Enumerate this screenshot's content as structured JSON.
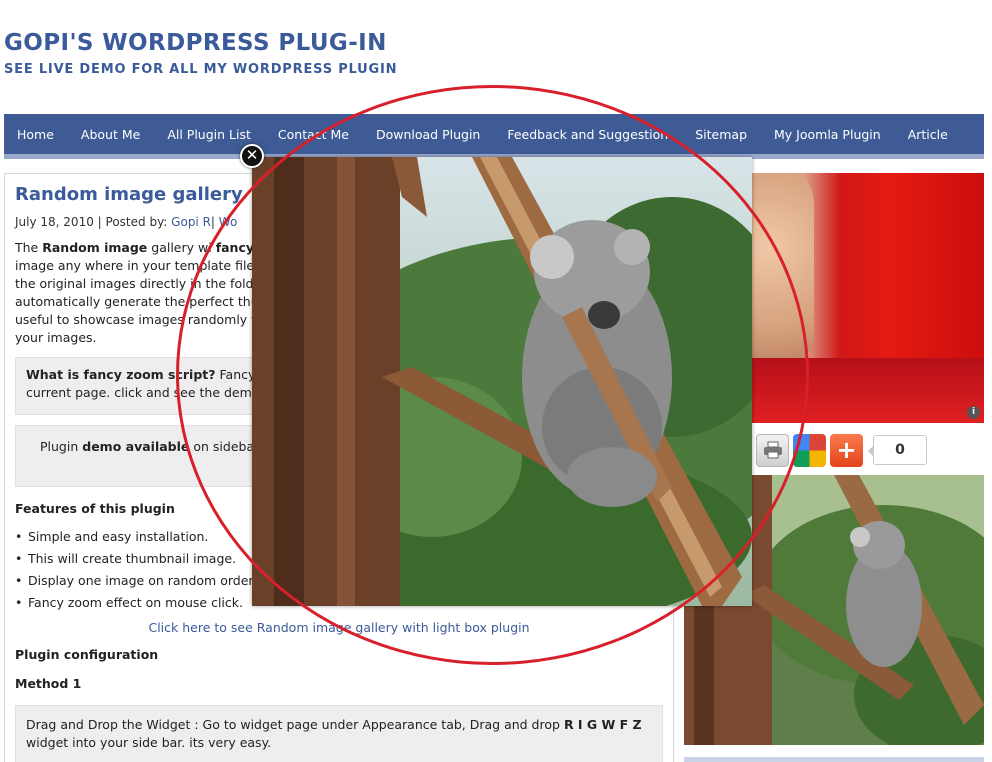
{
  "site": {
    "title": "GOPI'S WORDPRESS PLUG-IN",
    "description": "SEE LIVE DEMO FOR ALL MY WORDPRESS PLUGIN"
  },
  "nav": {
    "items": [
      "Home",
      "About Me",
      "All Plugin List",
      "Contact Me",
      "Download Plugin",
      "Feedback and Suggestion",
      "Sitemap",
      "My Joomla Plugin",
      "Article"
    ]
  },
  "post": {
    "title": "Random image gallery",
    "date": "July 18, 2010",
    "posted_by_label": "| Posted by:",
    "author": "Gopi R",
    "category_sep": "|",
    "category": "Wo",
    "intro": {
      "w1": "The",
      "b1": "Random image",
      "w2": "gallery wi",
      "b2": "fancy",
      "l2": "image any where in your template files",
      "l3": "the original images directly in the fold",
      "l4": "automatically generate the perfect thun",
      "l5": "useful to showcase images randomly to",
      "l6": "your images."
    },
    "box1": {
      "bold": "What is fancy zoom script?",
      "text": "Fancy",
      "line2": "current page. click and see the demo"
    },
    "box2": {
      "prefix": "Plugin",
      "bold": "demo available",
      "suffix": "on sidebar"
    },
    "features_heading": "Features of this plugin",
    "features": [
      "Simple and easy installation.",
      "This will create thumbnail image.",
      "Display one image on random order.",
      "Fancy zoom effect on mouse click."
    ],
    "lightbox_link": "Click here to see Random image gallery with light box plugin",
    "config_heading": "Plugin configuration",
    "method_heading": "Method 1",
    "box3": {
      "text": "Drag and Drop the Widget : Go to widget page under Appearance tab, Drag and drop",
      "bold": "R I G W F Z",
      "line2": "widget into your side bar. its very easy."
    }
  },
  "share": {
    "count": "0"
  },
  "lightbox": {
    "close_glyph": "✕"
  },
  "colors": {
    "brand": "#3a5a9a",
    "nav_bg": "#3f5b96",
    "annotation": "#d8202a"
  }
}
